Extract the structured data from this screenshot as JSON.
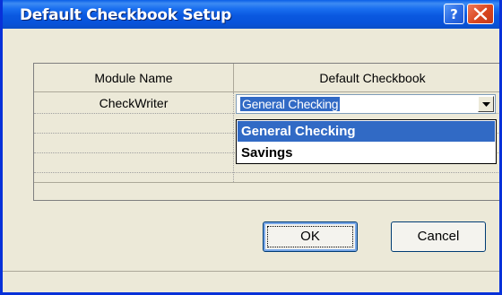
{
  "window": {
    "title": "Default Checkbook Setup",
    "help_icon": "question-mark-icon",
    "close_icon": "close-x-icon"
  },
  "grid": {
    "columns": [
      "Module Name",
      "Default Checkbook"
    ],
    "rows": [
      {
        "module": "CheckWriter",
        "checkbook": "General Checking"
      }
    ]
  },
  "dropdown": {
    "options": [
      "General Checking",
      "Savings"
    ],
    "selected": "General Checking",
    "arrow_icon": "chevron-down-icon"
  },
  "buttons": {
    "ok": "OK",
    "cancel": "Cancel"
  },
  "colors": {
    "titlebar": "#0a58e0",
    "selection": "#316ac5",
    "close": "#d9461f"
  }
}
